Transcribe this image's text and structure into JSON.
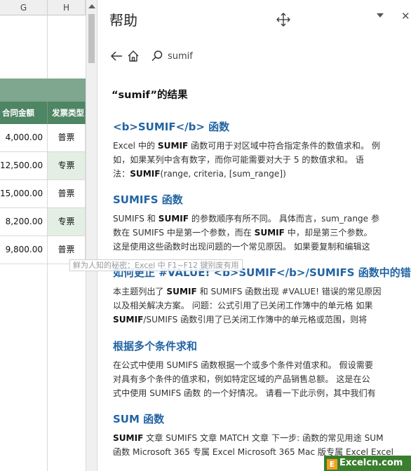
{
  "sheet": {
    "columns": [
      "G",
      "H"
    ],
    "header_row": [
      "合同金额",
      "发票类型"
    ],
    "rows": [
      {
        "amount": "4,000.00",
        "type": "普票"
      },
      {
        "amount": "12,500.00",
        "type": "专票"
      },
      {
        "amount": "15,000.00",
        "type": "普票"
      },
      {
        "amount": "8,200.00",
        "type": "专票"
      },
      {
        "amount": "9,800.00",
        "type": "普票"
      }
    ]
  },
  "tooltip": "鲜为人知的秘密：Excel 中 F1~F12 键别废有用",
  "help": {
    "title": "帮助",
    "search_value": "sumif",
    "results_heading": "“sumif”的结果",
    "results": [
      {
        "title": "<b>SUMIF</b> 函数",
        "lines": [
          [
            "Excel 中的 ",
            "SUMIF",
            " 函数可用于对区域中符合指定条件的数值求和。 例"
          ],
          [
            "如，如果某列中含有数字，而你可能需要对大于 5 的数值求和。 语"
          ],
          [
            "法：",
            "SUMIF",
            "(range, criteria, [sum_range])"
          ]
        ]
      },
      {
        "title": "SUMIFS 函数",
        "lines": [
          [
            "SUMIFS 和 ",
            "SUMIF",
            " 的参数顺序有所不同。 具体而言，sum_range 参"
          ],
          [
            "数在 SUMIFS 中是第一个参数，而在 ",
            "SUMIF",
            " 中，却是第三个参数。"
          ],
          [
            "这是使用这些函数时出现问题的一个常见原因。 如果要复制和编辑这"
          ]
        ]
      },
      {
        "title": "如何更正 #VALUE! <b>SUMIF</b>/SUMIFS 函数中的错误",
        "lines": [
          [
            "本主题列出了 ",
            "SUMIF",
            " 和 SUMIFS 函数出现 #VALUE! 错误的常见原因"
          ],
          [
            "以及相关解决方案。 问题：公式引用了已关闭工作簿中的单元格 如果"
          ],
          [
            "",
            "SUMIF",
            "/SUMIFS 函数引用了已关闭工作簿中的单元格或范围，则将"
          ]
        ]
      },
      {
        "title": "根据多个条件求和",
        "lines": [
          [
            "在公式中使用 SUMIFS 函数根据一个或多个条件对值求和。 假设需要"
          ],
          [
            "对具有多个条件的值求和，例如特定区域的产品销售总额。 这是在公"
          ],
          [
            "式中使用 SUMIFS 函数 的一个好情况。 请看一下此示例，其中我们有"
          ]
        ]
      },
      {
        "title": "SUM 函数",
        "lines": [
          [
            "",
            "SUMIF",
            " 文章 SUMIFS 文章 MATCH 文章 下一步: 函数的常见用途 SUM"
          ],
          [
            "函数 Microsoft 365 专属 Excel Microsoft 365 Mac 版专属 Excel Excel"
          ]
        ]
      }
    ]
  },
  "watermark": {
    "badge": "E",
    "text": "Excelcn.com"
  },
  "colors": {
    "link": "#2264a3",
    "header_green": "#4e8563",
    "band_green": "#7fa68f",
    "alt_fill": "#e3efe3"
  },
  "icons": [
    "back-arrow-icon",
    "home-icon",
    "search-icon",
    "move-icon",
    "dropdown-arrow-icon",
    "close-icon",
    "scroll-up-icon"
  ]
}
